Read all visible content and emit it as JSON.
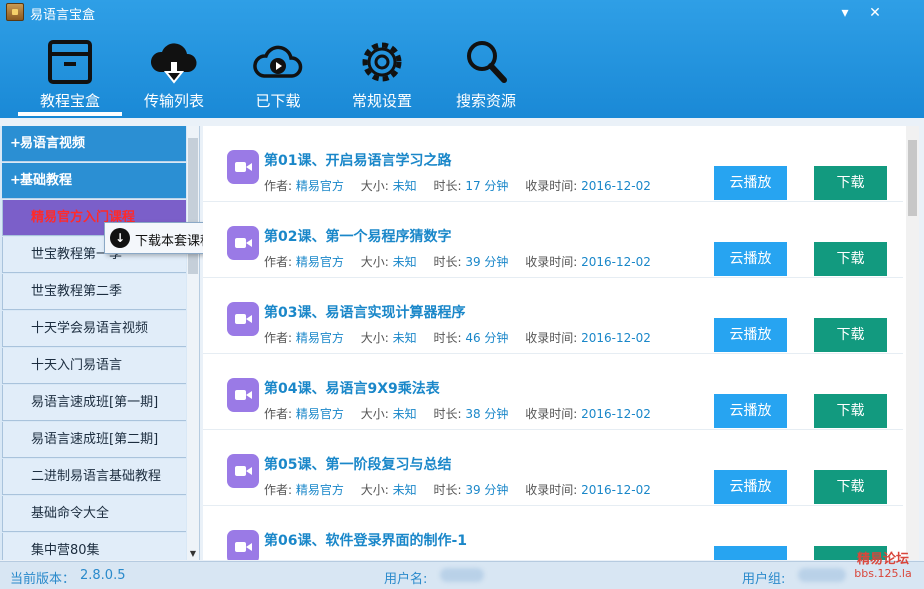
{
  "window": {
    "title": "易语言宝盒",
    "minimize_glyph": "▾",
    "close_glyph": "✕"
  },
  "nav": [
    {
      "label": "教程宝盒",
      "icon": "box-icon",
      "active": true
    },
    {
      "label": "传输列表",
      "icon": "cloud-download-icon",
      "active": false
    },
    {
      "label": "已下载",
      "icon": "cloud-play-icon",
      "active": false
    },
    {
      "label": "常规设置",
      "icon": "gear-icon",
      "active": false
    },
    {
      "label": "搜索资源",
      "icon": "search-icon",
      "active": false
    }
  ],
  "sidebar": {
    "categories": [
      {
        "label": "易语言视频"
      },
      {
        "label": "基础教程"
      }
    ],
    "items": [
      {
        "label": "精易官方入门课程",
        "active": true
      },
      {
        "label": "世宝教程第一季"
      },
      {
        "label": "世宝教程第二季"
      },
      {
        "label": "十天学会易语言视频"
      },
      {
        "label": "十天入门易语言"
      },
      {
        "label": "易语言速成班[第一期]"
      },
      {
        "label": "易语言速成班[第二期]"
      },
      {
        "label": "二进制易语言基础教程"
      },
      {
        "label": "基础命令大全"
      },
      {
        "label": "集中营80集"
      }
    ],
    "scroll_down_glyph": "▼"
  },
  "context_menu": {
    "label": "下载本套课程",
    "icon_glyph": "↓"
  },
  "meta_keys": {
    "author": "作者:",
    "size": "大小:",
    "duration": "时长:",
    "date": "收录时间:"
  },
  "buttons": {
    "play": "云播放",
    "download": "下载"
  },
  "lessons": [
    {
      "title": "第01课、开启易语言学习之路",
      "author": "精易官方",
      "size": "未知",
      "duration": "17 分钟",
      "date": "2016-12-02"
    },
    {
      "title": "第02课、第一个易程序猜数字",
      "author": "精易官方",
      "size": "未知",
      "duration": "39 分钟",
      "date": "2016-12-02"
    },
    {
      "title": "第03课、易语言实现计算器程序",
      "author": "精易官方",
      "size": "未知",
      "duration": "46 分钟",
      "date": "2016-12-02"
    },
    {
      "title": "第04课、易语言9X9乘法表",
      "author": "精易官方",
      "size": "未知",
      "duration": "38 分钟",
      "date": "2016-12-02"
    },
    {
      "title": "第05课、第一阶段复习与总结",
      "author": "精易官方",
      "size": "未知",
      "duration": "39 分钟",
      "date": "2016-12-02"
    },
    {
      "title": "第06课、软件登录界面的制作-1"
    }
  ],
  "status": {
    "version_label": "当前版本：",
    "version": "2.8.0.5",
    "user_label": "用户名:",
    "group_label": "用户组:"
  },
  "watermark": {
    "line1": "精易论坛",
    "line2": "bbs.125.la"
  },
  "colors": {
    "header_blue": "#1a89d6",
    "link_blue": "#1a87c9",
    "play_button": "#27a4f1",
    "download_button": "#129a7f",
    "video_icon": "#9a7ae6",
    "active_item_bg": "#7b5fc9",
    "active_item_text": "#ff2a2a"
  }
}
